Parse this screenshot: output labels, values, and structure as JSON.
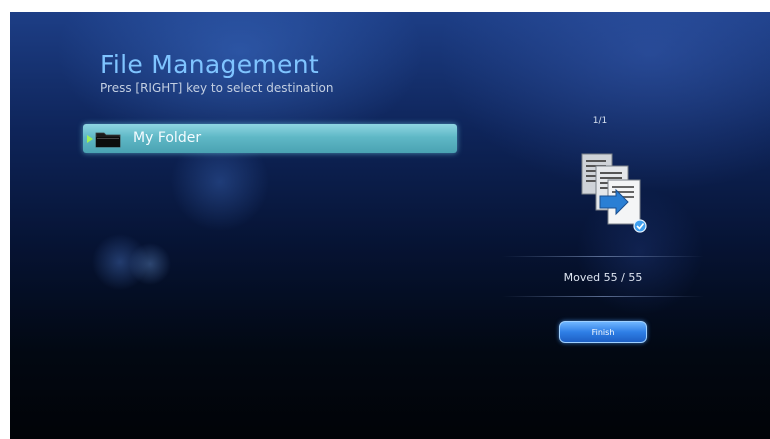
{
  "header": {
    "title": "File Management",
    "instruction": "Press [RIGHT] key to select destination"
  },
  "folder_list": {
    "items": [
      {
        "label": "My Folder",
        "icon": "folder-icon",
        "selected": true
      }
    ]
  },
  "side_panel": {
    "page_indicator": "1/1",
    "icon": "documents-moved-icon",
    "status": "Moved 55 / 55",
    "finish_label": "Finish"
  },
  "colors": {
    "title": "#7fc4ff",
    "selection_highlight": "#5fb8c6",
    "button": "#2f7fe6"
  }
}
